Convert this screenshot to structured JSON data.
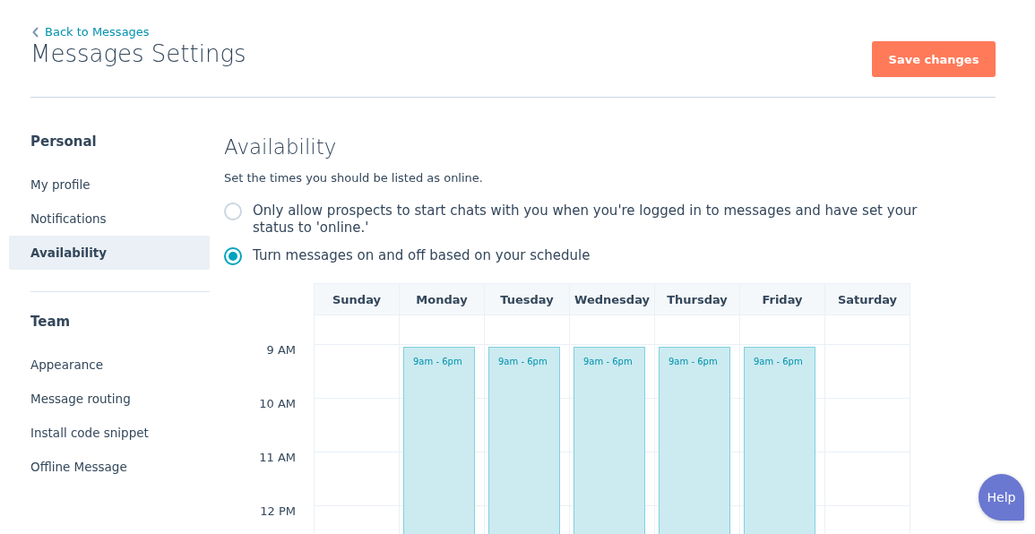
{
  "header": {
    "back_link": "Back to Messages",
    "title": "Messages Settings",
    "save_button": "Save changes"
  },
  "sidebar": {
    "sections": [
      {
        "heading": "Personal",
        "items": [
          {
            "label": "My profile",
            "selected": false
          },
          {
            "label": "Notifications",
            "selected": false
          },
          {
            "label": "Availability",
            "selected": true
          }
        ]
      },
      {
        "heading": "Team",
        "items": [
          {
            "label": "Appearance",
            "selected": false
          },
          {
            "label": "Message routing",
            "selected": false
          },
          {
            "label": "Install code snippet",
            "selected": false
          },
          {
            "label": "Offline Message",
            "selected": false
          }
        ]
      }
    ]
  },
  "main": {
    "title": "Availability",
    "description": "Set the times you should be listed as online.",
    "options": [
      {
        "label": "Only allow prospects to start chats with you when you're logged in to messages and have set your status to 'online.'",
        "selected": false
      },
      {
        "label": "Turn messages on and off based on your schedule",
        "selected": true
      }
    ],
    "schedule": {
      "hours": [
        "9 AM",
        "10 AM",
        "11 AM",
        "12 PM"
      ],
      "days": [
        {
          "label": "Sunday"
        },
        {
          "label": "Monday",
          "block": "9am - 6pm"
        },
        {
          "label": "Tuesday",
          "block": "9am - 6pm"
        },
        {
          "label": "Wednesday",
          "block": "9am - 6pm"
        },
        {
          "label": "Thursday",
          "block": "9am - 6pm"
        },
        {
          "label": "Friday",
          "block": "9am - 6pm"
        },
        {
          "label": "Saturday"
        }
      ]
    }
  },
  "help_button": "Help"
}
